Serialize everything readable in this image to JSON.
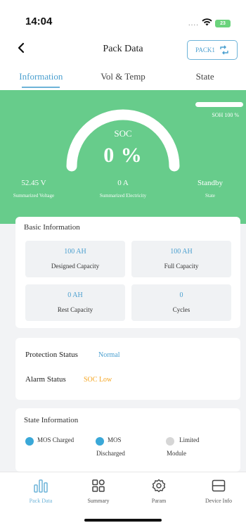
{
  "status_bar": {
    "time": "14:04",
    "signal_dots": "....",
    "battery_text": "23"
  },
  "nav": {
    "title": "Pack Data",
    "pack_button_label": "PACK1"
  },
  "tabs": [
    {
      "label": "Information",
      "active": true
    },
    {
      "label": "Vol & Temp",
      "active": false
    },
    {
      "label": "State",
      "active": false
    }
  ],
  "hero": {
    "soc_label": "SOC",
    "soc_value": "0 %",
    "soc_fraction": 0,
    "soh_text": "SOH 100 %",
    "soh_fraction": 1.0,
    "stats": [
      {
        "value": "52.45 V",
        "label": "Summarized Voltage"
      },
      {
        "value": "0 A",
        "label": "Summarized Electricity"
      },
      {
        "value": "Standby",
        "label": "State"
      }
    ],
    "colors": {
      "background": "#67cc8b",
      "arc": "#ffffff"
    }
  },
  "basic_info": {
    "title": "Basic Information",
    "tiles": [
      {
        "value": "100 AH",
        "label": "Designed Capacity"
      },
      {
        "value": "100 AH",
        "label": "Full Capacity"
      },
      {
        "value": "0 AH",
        "label": "Rest Capacity"
      },
      {
        "value": "0",
        "label": "Cycles"
      }
    ]
  },
  "status": {
    "protection_label": "Protection Status",
    "protection_value": "Normal",
    "alarm_label": "Alarm Status",
    "alarm_value": "SOC Low",
    "colors": {
      "normal": "#4a9fcf",
      "warning": "#f5a623"
    }
  },
  "state_info": {
    "title": "State Information",
    "items": [
      {
        "line1": "MOS Charged",
        "line2": "",
        "color": "#3aa8d8"
      },
      {
        "line1": "MOS",
        "line2": "Discharged",
        "color": "#3aa8d8"
      },
      {
        "line1": "Limited",
        "line2": "Module",
        "color": "#d6d6d6"
      }
    ]
  },
  "bottom_tabs": [
    {
      "label": "Pack Data",
      "icon": "bar-chart-icon",
      "active": true
    },
    {
      "label": "Summary",
      "icon": "grid-icon",
      "active": false
    },
    {
      "label": "Param",
      "icon": "gear-icon",
      "active": false
    },
    {
      "label": "Device Info",
      "icon": "device-icon",
      "active": false
    }
  ]
}
